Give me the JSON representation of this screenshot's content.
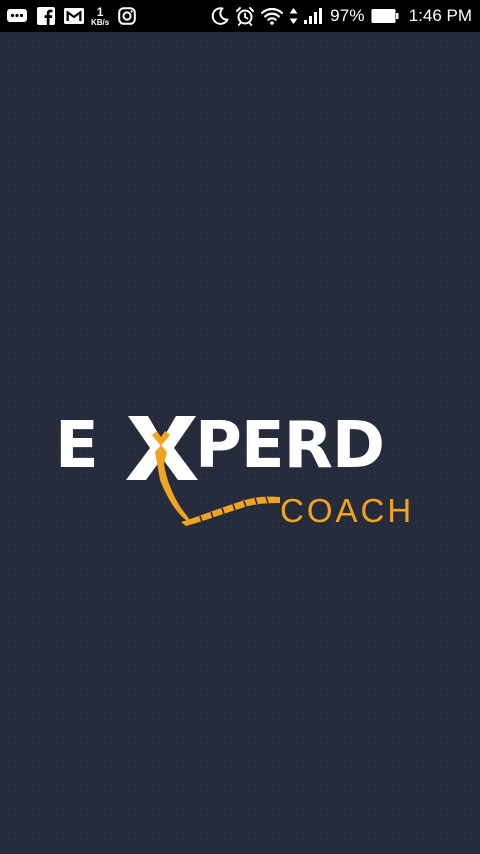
{
  "status_bar": {
    "network_speed": {
      "value": "1",
      "unit": "KB/s"
    },
    "battery_percent": "97%",
    "time": "1:46 PM",
    "icons": [
      "chat-bubble-icon",
      "facebook-icon",
      "gmail-icon",
      "instagram-icon",
      "do-not-disturb-icon",
      "alarm-icon",
      "wifi-icon",
      "data-arrows-icon",
      "signal-icon",
      "battery-icon"
    ]
  },
  "splash": {
    "logo_text_left": "E",
    "logo_text_right": "PERD",
    "logo_subtext": "COACH"
  },
  "colors": {
    "background": "#262b3c",
    "logo_white": "#ffffff",
    "logo_accent": "#f1a41f",
    "status_bar": "#000000"
  }
}
